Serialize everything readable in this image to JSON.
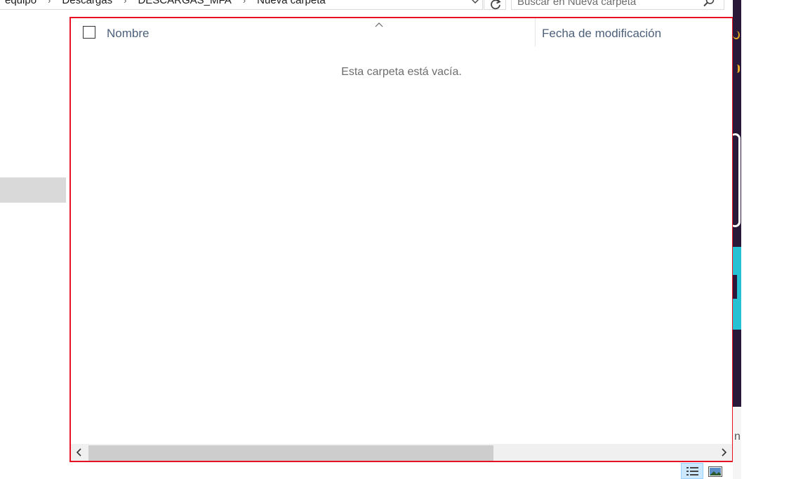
{
  "address_bar": {
    "crumbs": [
      "equipo",
      "Descargas",
      "DESCARGAS_MFA",
      "Nueva carpeta"
    ],
    "separator": "›"
  },
  "search": {
    "placeholder": "Buscar en Nueva carpeta"
  },
  "file_list": {
    "columns": {
      "name": "Nombre",
      "date_modified": "Fecha de modificación"
    },
    "empty_message": "Esta carpeta está vacía."
  },
  "desktop_strip": {
    "partial_text": "n"
  },
  "icons": {
    "dropdown": "chevron-down-icon",
    "refresh": "refresh-icon",
    "search": "search-icon",
    "sort": "sort-ascending-icon",
    "scroll_left": "chevron-left-icon",
    "scroll_right": "chevron-right-icon",
    "details_view": "details-view-icon",
    "large_icons_view": "large-icons-view-icon"
  },
  "colors": {
    "selection_border": "#e81123",
    "header_text": "#4c607a",
    "muted_text": "#6d6d6d",
    "active_view_bg": "#cce8ff"
  }
}
